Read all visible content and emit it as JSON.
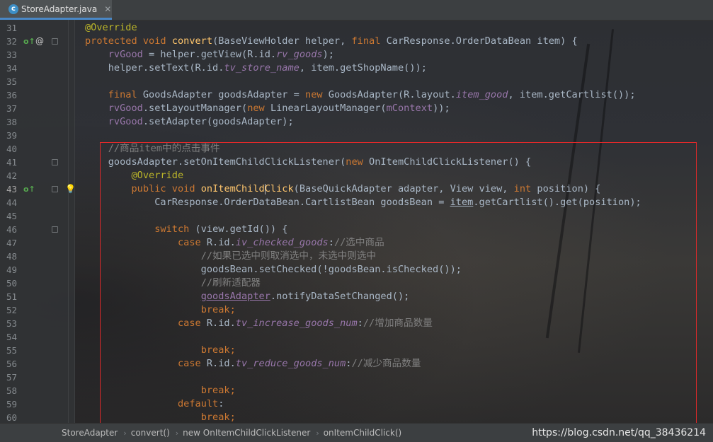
{
  "tab": {
    "filename": "StoreAdapter.java",
    "icon": "java-class-icon"
  },
  "lines": [
    {
      "n": "31",
      "parts": [
        [
          "an",
          "@Override"
        ]
      ]
    },
    {
      "n": "32",
      "parts": [
        [
          "kw",
          "protected void "
        ],
        [
          "fn",
          "convert"
        ],
        [
          "p",
          "(BaseViewHolder helper, "
        ],
        [
          "kw",
          "final "
        ],
        [
          "p",
          "CarResponse.OrderDataBean item) {"
        ]
      ],
      "markers": [
        "override",
        "at",
        "fold"
      ]
    },
    {
      "n": "33",
      "parts": [
        [
          "p",
          "    "
        ],
        [
          "fld",
          "rvGood"
        ],
        [
          "p",
          " = helper.getView(R.id."
        ],
        [
          "fldi",
          "rv_goods"
        ],
        [
          "p",
          ");"
        ]
      ]
    },
    {
      "n": "34",
      "parts": [
        [
          "p",
          "    helper.setText(R.id."
        ],
        [
          "fldi",
          "tv_store_name"
        ],
        [
          "p",
          ", item.getShopName());"
        ]
      ]
    },
    {
      "n": "35",
      "parts": []
    },
    {
      "n": "36",
      "parts": [
        [
          "p",
          "    "
        ],
        [
          "kw",
          "final "
        ],
        [
          "p",
          "GoodsAdapter goodsAdapter = "
        ],
        [
          "kw",
          "new "
        ],
        [
          "p",
          "GoodsAdapter(R.layout."
        ],
        [
          "fldi",
          "item_good"
        ],
        [
          "p",
          ", item.getCartlist());"
        ]
      ]
    },
    {
      "n": "37",
      "parts": [
        [
          "p",
          "    "
        ],
        [
          "fld",
          "rvGood"
        ],
        [
          "p",
          ".setLayoutManager("
        ],
        [
          "kw",
          "new "
        ],
        [
          "p",
          "LinearLayoutManager("
        ],
        [
          "fld",
          "mContext"
        ],
        [
          "p",
          "));"
        ]
      ]
    },
    {
      "n": "38",
      "parts": [
        [
          "p",
          "    "
        ],
        [
          "fld",
          "rvGood"
        ],
        [
          "p",
          ".setAdapter(goodsAdapter);"
        ]
      ]
    },
    {
      "n": "39",
      "parts": []
    },
    {
      "n": "40",
      "parts": [
        [
          "p",
          "    "
        ],
        [
          "cm",
          "//商品item中的点击事件"
        ]
      ]
    },
    {
      "n": "41",
      "parts": [
        [
          "p",
          "    goodsAdapter.setOnItemChildClickListener("
        ],
        [
          "kw",
          "new "
        ],
        [
          "p",
          "OnItemChildClickListener() {"
        ]
      ],
      "markers": [
        "fold"
      ]
    },
    {
      "n": "42",
      "parts": [
        [
          "p",
          "        "
        ],
        [
          "an",
          "@Override"
        ]
      ]
    },
    {
      "n": "43",
      "parts": [
        [
          "p",
          "        "
        ],
        [
          "kw",
          "public void "
        ],
        [
          "fn",
          "onItemChild"
        ],
        [
          "caret",
          ""
        ],
        [
          "fn",
          "Click"
        ],
        [
          "p",
          "(BaseQuickAdapter adapter, View view, "
        ],
        [
          "kw",
          "int "
        ],
        [
          "p",
          "position) {"
        ]
      ],
      "markers": [
        "override",
        "fold",
        "bulb"
      ],
      "current": true
    },
    {
      "n": "44",
      "parts": [
        [
          "p",
          "            CarResponse.OrderDataBean.CartlistBean goodsBean = "
        ],
        [
          "ul",
          "item"
        ],
        [
          "p",
          ".getCartlist().get(position);"
        ]
      ]
    },
    {
      "n": "45",
      "parts": []
    },
    {
      "n": "46",
      "parts": [
        [
          "p",
          "            "
        ],
        [
          "kw",
          "switch "
        ],
        [
          "p",
          "(view.getId()) {"
        ]
      ],
      "markers": [
        "fold"
      ]
    },
    {
      "n": "47",
      "parts": [
        [
          "p",
          "                "
        ],
        [
          "kw",
          "case "
        ],
        [
          "p",
          "R.id."
        ],
        [
          "fldi",
          "iv_checked_goods"
        ],
        [
          "p",
          ":"
        ],
        [
          "cm",
          "//选中商品"
        ]
      ]
    },
    {
      "n": "48",
      "parts": [
        [
          "p",
          "                    "
        ],
        [
          "cm",
          "//如果已选中则取消选中，未选中则选中"
        ]
      ]
    },
    {
      "n": "49",
      "parts": [
        [
          "p",
          "                    goodsBean.setChecked(!goodsBean.isChecked());"
        ]
      ]
    },
    {
      "n": "50",
      "parts": [
        [
          "p",
          "                    "
        ],
        [
          "cm",
          "//刷新适配器"
        ]
      ]
    },
    {
      "n": "51",
      "parts": [
        [
          "p",
          "                    "
        ],
        [
          "ulf",
          "goodsAdapter"
        ],
        [
          "p",
          ".notifyDataSetChanged();"
        ]
      ]
    },
    {
      "n": "52",
      "parts": [
        [
          "p",
          "                    "
        ],
        [
          "kw",
          "break;"
        ]
      ]
    },
    {
      "n": "53",
      "parts": [
        [
          "p",
          "                "
        ],
        [
          "kw",
          "case "
        ],
        [
          "p",
          "R.id."
        ],
        [
          "fldi",
          "tv_increase_goods_num"
        ],
        [
          "p",
          ":"
        ],
        [
          "cm",
          "//增加商品数量"
        ]
      ]
    },
    {
      "n": "54",
      "parts": []
    },
    {
      "n": "55",
      "parts": [
        [
          "p",
          "                    "
        ],
        [
          "kw",
          "break;"
        ]
      ]
    },
    {
      "n": "56",
      "parts": [
        [
          "p",
          "                "
        ],
        [
          "kw",
          "case "
        ],
        [
          "p",
          "R.id."
        ],
        [
          "fldi",
          "tv_reduce_goods_num"
        ],
        [
          "p",
          ":"
        ],
        [
          "cm",
          "//减少商品数量"
        ]
      ]
    },
    {
      "n": "57",
      "parts": []
    },
    {
      "n": "58",
      "parts": [
        [
          "p",
          "                    "
        ],
        [
          "kw",
          "break;"
        ]
      ]
    },
    {
      "n": "59",
      "parts": [
        [
          "p",
          "                "
        ],
        [
          "kw",
          "default"
        ],
        [
          "p",
          ":"
        ]
      ]
    },
    {
      "n": "60",
      "parts": [
        [
          "p",
          "                    "
        ],
        [
          "kw",
          "break;"
        ]
      ]
    }
  ],
  "breadcrumb": [
    "StoreAdapter",
    "convert()",
    "new OnItemChildClickListener",
    "onItemChildClick()"
  ],
  "watermark": "https://blog.csdn.net/qq_38436214",
  "colors": {
    "keyword": "#cc7832",
    "annotation": "#bbb529",
    "method": "#ffc66d",
    "field": "#9876aa",
    "comment": "#808080",
    "text": "#a9b7c6",
    "highlight_box": "#e0292a"
  }
}
